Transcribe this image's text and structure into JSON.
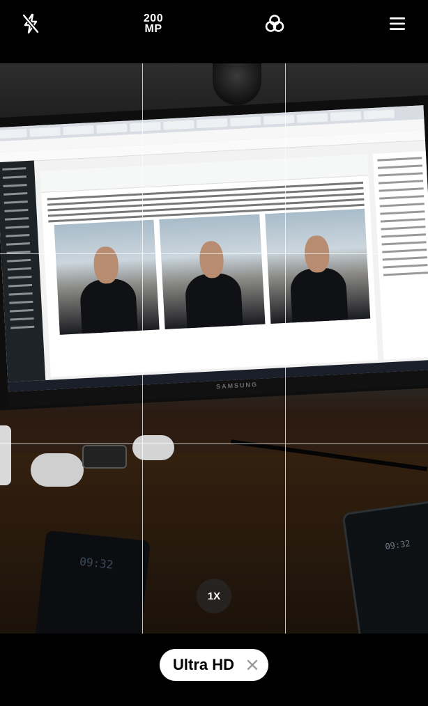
{
  "top_bar": {
    "flash_icon": "flash-off-icon",
    "megapixel_line1": "200",
    "megapixel_line2": "MP",
    "filters_icon": "filters-icon",
    "menu_icon": "hamburger-menu-icon"
  },
  "viewfinder": {
    "monitor_brand": "SAMSUNG",
    "phone_left_clock": "09:32",
    "phone_right_clock": "09:32",
    "grid": "on"
  },
  "zoom": {
    "label": "1X"
  },
  "mode": {
    "label": "Ultra HD",
    "close_icon": "close-icon"
  },
  "colors": {
    "background": "#000000",
    "grid_lines": "#ffffff",
    "pill_background": "#ffffff",
    "pill_text": "#000000",
    "close_icon": "#9a9a9a"
  }
}
